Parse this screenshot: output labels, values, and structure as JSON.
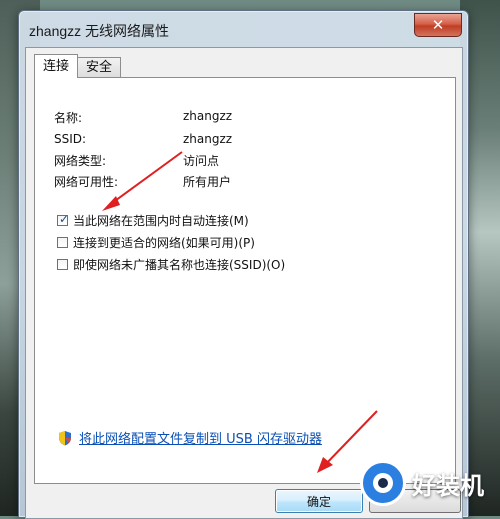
{
  "window": {
    "title": "zhangzz 无线网络属性",
    "close_glyph": "✕"
  },
  "tabs": [
    {
      "label": "连接",
      "active": true
    },
    {
      "label": "安全",
      "active": false
    }
  ],
  "info": [
    {
      "label": "名称:",
      "value": "zhangzz"
    },
    {
      "label": "SSID:",
      "value": "zhangzz"
    },
    {
      "label": "网络类型:",
      "value": "访问点"
    },
    {
      "label": "网络可用性:",
      "value": "所有用户"
    }
  ],
  "options": [
    {
      "label": "当此网络在范围内时自动连接(M)",
      "checked": true
    },
    {
      "label": "连接到更适合的网络(如果可用)(P)",
      "checked": false
    },
    {
      "label": "即使网络未广播其名称也连接(SSID)(O)",
      "checked": false
    }
  ],
  "copy_link": {
    "label": "将此网络配置文件复制到 USB 闪存驱动器",
    "icon": "shield-icon"
  },
  "buttons": {
    "ok_label": "确定"
  },
  "watermark": {
    "text": "好装机"
  },
  "colors": {
    "link": "#0a4fb5",
    "arrow": "#e02020",
    "watermark": "#2b7fe0"
  }
}
